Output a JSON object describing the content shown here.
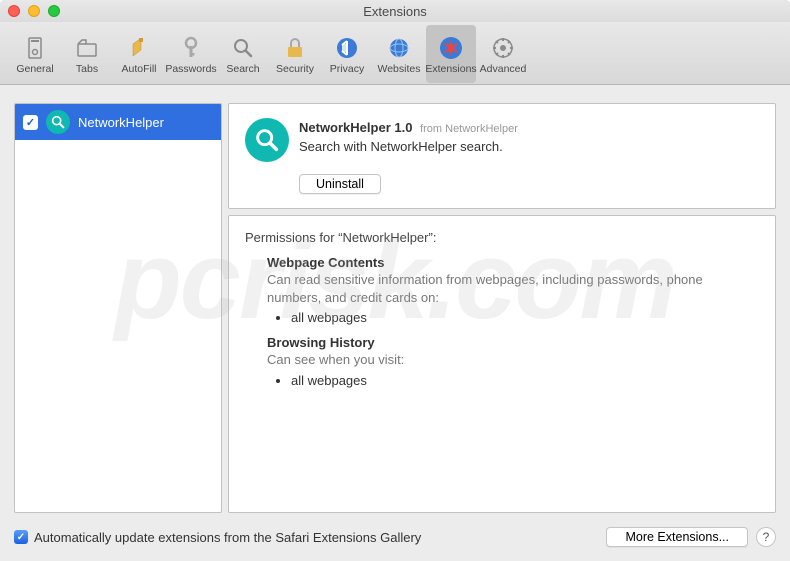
{
  "window": {
    "title": "Extensions"
  },
  "toolbar": {
    "items": [
      {
        "label": "General",
        "icon": "general"
      },
      {
        "label": "Tabs",
        "icon": "tabs"
      },
      {
        "label": "AutoFill",
        "icon": "autofill"
      },
      {
        "label": "Passwords",
        "icon": "passwords"
      },
      {
        "label": "Search",
        "icon": "search"
      },
      {
        "label": "Security",
        "icon": "security"
      },
      {
        "label": "Privacy",
        "icon": "privacy"
      },
      {
        "label": "Websites",
        "icon": "websites"
      },
      {
        "label": "Extensions",
        "icon": "extensions"
      },
      {
        "label": "Advanced",
        "icon": "advanced"
      }
    ],
    "activeIndex": 8
  },
  "sidebar": {
    "extensions": [
      {
        "name": "NetworkHelper",
        "checked": true
      }
    ]
  },
  "detail": {
    "title": "NetworkHelper 1.0",
    "from": "from NetworkHelper",
    "description": "Search with NetworkHelper search.",
    "uninstall_label": "Uninstall"
  },
  "permissions": {
    "header": "Permissions for “NetworkHelper”:",
    "sections": [
      {
        "heading": "Webpage Contents",
        "desc": "Can read sensitive information from webpages, including passwords, phone numbers, and credit cards on:",
        "items": [
          "all webpages"
        ]
      },
      {
        "heading": "Browsing History",
        "desc": "Can see when you visit:",
        "items": [
          "all webpages"
        ]
      }
    ]
  },
  "footer": {
    "auto_update_label": "Automatically update extensions from the Safari Extensions Gallery",
    "auto_update_checked": true,
    "more_label": "More Extensions...",
    "help_label": "?"
  },
  "watermark": "pcrisk.com"
}
